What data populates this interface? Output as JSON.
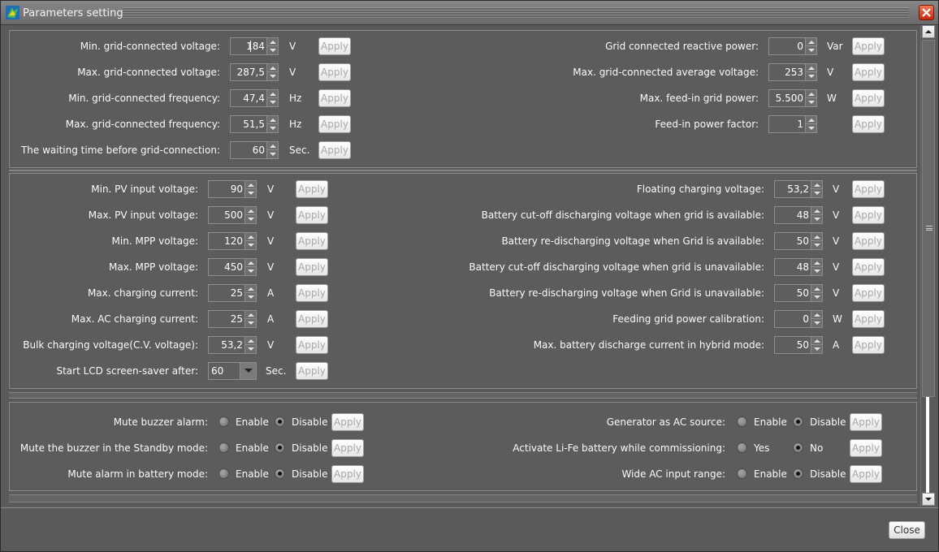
{
  "window": {
    "title": "Parameters setting",
    "close_label": "Close"
  },
  "apply_label": "Apply",
  "grid_left": [
    {
      "label": "Min. grid-connected voltage:",
      "value": "184",
      "unit": "V"
    },
    {
      "label": "Max. grid-connected voltage:",
      "value": "287,5",
      "unit": "V"
    },
    {
      "label": "Min. grid-connected frequency:",
      "value": "47,4",
      "unit": "Hz"
    },
    {
      "label": "Max. grid-connected frequency:",
      "value": "51,5",
      "unit": "Hz"
    },
    {
      "label": "The waiting time before grid-connection:",
      "value": "60",
      "unit": "Sec."
    }
  ],
  "grid_right": [
    {
      "label": "Grid connected reactive power:",
      "value": "0",
      "unit": "Var"
    },
    {
      "label": "Max. grid-connected average voltage:",
      "value": "253",
      "unit": "V"
    },
    {
      "label": "Max. feed-in grid power:",
      "value": "5.500",
      "unit": "W"
    },
    {
      "label": "Feed-in power factor:",
      "value": "1",
      "unit": ""
    }
  ],
  "pv_left": [
    {
      "label": "Min. PV input voltage:",
      "value": "90",
      "unit": "V"
    },
    {
      "label": "Max. PV input voltage:",
      "value": "500",
      "unit": "V"
    },
    {
      "label": "Min. MPP voltage:",
      "value": "120",
      "unit": "V"
    },
    {
      "label": "Max. MPP voltage:",
      "value": "450",
      "unit": "V"
    },
    {
      "label": "Max. charging current:",
      "value": "25",
      "unit": "A"
    },
    {
      "label": "Max. AC charging current:",
      "value": "25",
      "unit": "A"
    },
    {
      "label": "Bulk charging voltage(C.V. voltage):",
      "value": "53,2",
      "unit": "V"
    }
  ],
  "lcd": {
    "label": "Start LCD screen-saver after:",
    "value": "60",
    "unit": "Sec."
  },
  "pv_right": [
    {
      "label": "Floating charging voltage:",
      "value": "53,2",
      "unit": "V"
    },
    {
      "label": "Battery cut-off discharging voltage when grid is available:",
      "value": "48",
      "unit": "V"
    },
    {
      "label": "Battery re-discharging voltage when Grid is available:",
      "value": "50",
      "unit": "V"
    },
    {
      "label": "Battery cut-off discharging voltage when grid is unavailable:",
      "value": "48",
      "unit": "V"
    },
    {
      "label": "Battery re-discharging voltage when Grid is unavailable:",
      "value": "50",
      "unit": "V"
    },
    {
      "label": "Feeding grid power calibration:",
      "value": "0",
      "unit": "W"
    },
    {
      "label": "Max. battery discharge current in hybrid mode:",
      "value": "50",
      "unit": "A"
    }
  ],
  "toggles_left": [
    {
      "label": "Mute buzzer alarm:",
      "opt1": "Enable",
      "opt2": "Disable",
      "selected": "opt2"
    },
    {
      "label": "Mute the buzzer in the Standby mode:",
      "opt1": "Enable",
      "opt2": "Disable",
      "selected": "opt2"
    },
    {
      "label": "Mute alarm in battery mode:",
      "opt1": "Enable",
      "opt2": "Disable",
      "selected": "opt2"
    }
  ],
  "toggles_right": [
    {
      "label": "Generator as AC source:",
      "opt1": "Enable",
      "opt2": "Disable",
      "selected": "opt2"
    },
    {
      "label": "Activate Li-Fe battery while commissioning:",
      "opt1": "Yes",
      "opt2": "No",
      "selected": "opt2"
    },
    {
      "label": "Wide AC input range:",
      "opt1": "Enable",
      "opt2": "Disable",
      "selected": "opt2"
    }
  ]
}
